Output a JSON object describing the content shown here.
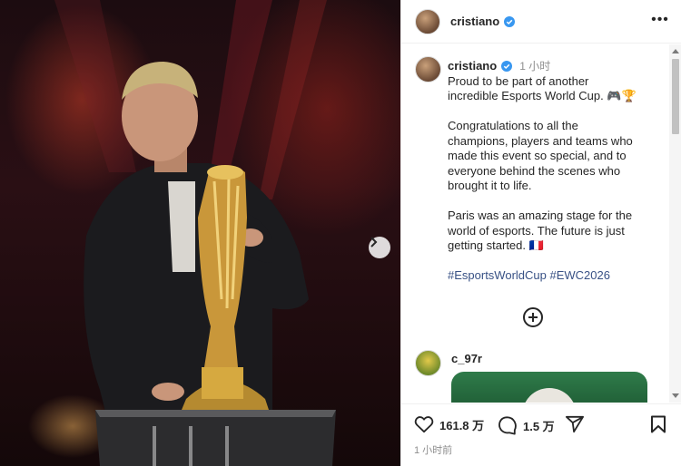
{
  "post": {
    "username": "cristiano",
    "verified": true,
    "time_ago": "1 小时",
    "caption_lines_1": [
      "Proud to be part of another",
      "incredible Esports World Cup. 🎮🏆"
    ],
    "caption_lines_2": [
      "Congratulations to all the",
      "champions, players and teams who",
      "made this event so special, and to",
      "everyone behind the scenes who",
      "brought it to life."
    ],
    "caption_lines_3": [
      "Paris was an amazing stage for the",
      "world of esports. The future is just",
      "getting started. 🇫🇷"
    ],
    "hashtags": [
      "#EsportsWorldCup",
      "#EWC2026"
    ],
    "likes": "161.8 万",
    "comments": "1.5 万",
    "posted": "1 小时前"
  },
  "comment": {
    "username": "c_97r"
  },
  "icons": {
    "more": "more-options-icon",
    "verified": "verified-badge-icon",
    "load_more": "plus-circle-icon",
    "like": "heart-icon",
    "comment": "comment-bubble-icon",
    "share": "paper-plane-icon",
    "save": "bookmark-icon",
    "next": "chevron-right-icon"
  },
  "colors": {
    "verified": "#3897f0",
    "hashtag": "#385185",
    "muted": "#8e8e8e"
  }
}
